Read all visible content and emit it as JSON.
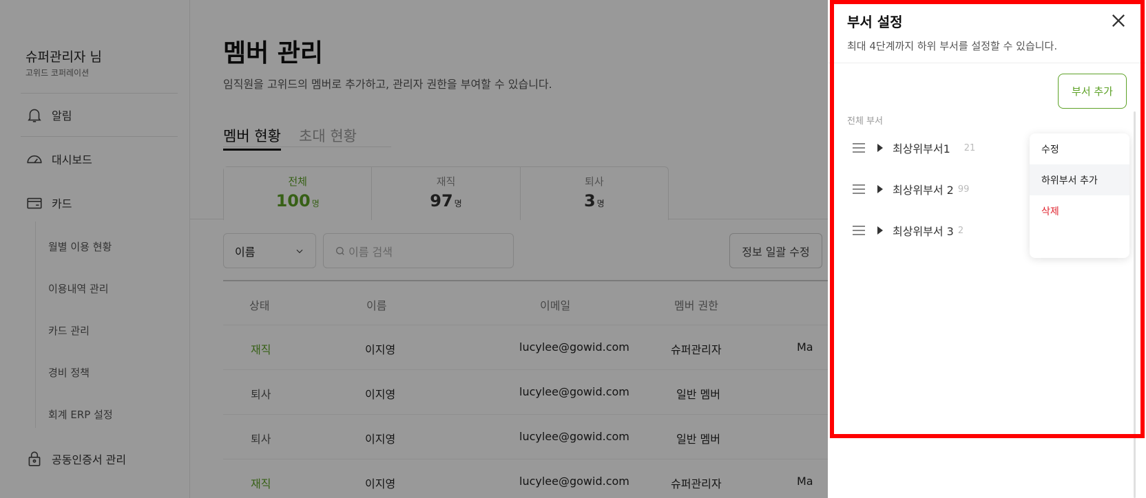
{
  "sidebar": {
    "user_name": "슈퍼관리자 님",
    "company": "고위드 코퍼레이션",
    "nav": [
      {
        "label": "알림",
        "icon": "bell-icon"
      },
      {
        "label": "대시보드",
        "icon": "gauge-icon"
      },
      {
        "label": "카드",
        "icon": "card-icon"
      }
    ],
    "card_sub": [
      "월별 이용 현황",
      "이용내역 관리",
      "카드 관리",
      "경비 정책",
      "회계 ERP 설정"
    ],
    "cert": {
      "label": "공동인증서 관리",
      "icon": "lock-icon"
    }
  },
  "main": {
    "title": "멤버 관리",
    "description": "임직원을 고위드의 멤버로 추가하고, 관리자 권한을 부여할 수 있습니다.",
    "tabs": [
      {
        "label": "멤버 현황",
        "active": true
      },
      {
        "label": "초대 현황",
        "active": false
      }
    ],
    "stats": [
      {
        "label": "전체",
        "value": "100",
        "unit": "명",
        "active": true
      },
      {
        "label": "재직",
        "value": "97",
        "unit": "명",
        "active": false
      },
      {
        "label": "퇴사",
        "value": "3",
        "unit": "명",
        "active": false
      }
    ],
    "filter": {
      "selected": "이름",
      "search_placeholder": "이름 검색"
    },
    "bulk_edit_label": "정보 일괄 수정",
    "table": {
      "headers": [
        "상태",
        "이름",
        "이메일",
        "멤버 권한"
      ],
      "rows": [
        {
          "status": "재직",
          "name": "이지영",
          "email": "lucylee@gowid.com",
          "role": "슈퍼관리자",
          "extra": "Ma"
        },
        {
          "status": "퇴사",
          "name": "이지영",
          "email": "lucylee@gowid.com",
          "role": "일반 멤버",
          "extra": ""
        },
        {
          "status": "퇴사",
          "name": "이지영",
          "email": "lucylee@gowid.com",
          "role": "일반 멤버",
          "extra": ""
        },
        {
          "status": "재직",
          "name": "이지영",
          "email": "lucylee@gowid.com",
          "role": "슈퍼관리자",
          "extra": "Ma"
        }
      ]
    }
  },
  "drawer": {
    "title": "부서 설정",
    "description": "최대 4단계까지 하위 부서를 설정할 수 있습니다.",
    "add_button": "부서 추가",
    "section_label": "전체 부서",
    "departments": [
      {
        "name": "최상위부서1",
        "count": "21"
      },
      {
        "name": "최상위부서 2",
        "count": "99"
      },
      {
        "name": "최상위부서 3",
        "count": "2"
      }
    ],
    "context_menu": [
      {
        "label": "수정",
        "type": "normal"
      },
      {
        "label": "하위부서 추가",
        "type": "hover"
      },
      {
        "label": "삭제",
        "type": "danger"
      }
    ]
  },
  "colors": {
    "accent": "#5ca125",
    "danger": "#e0242f",
    "highlight": "#ff0000"
  }
}
